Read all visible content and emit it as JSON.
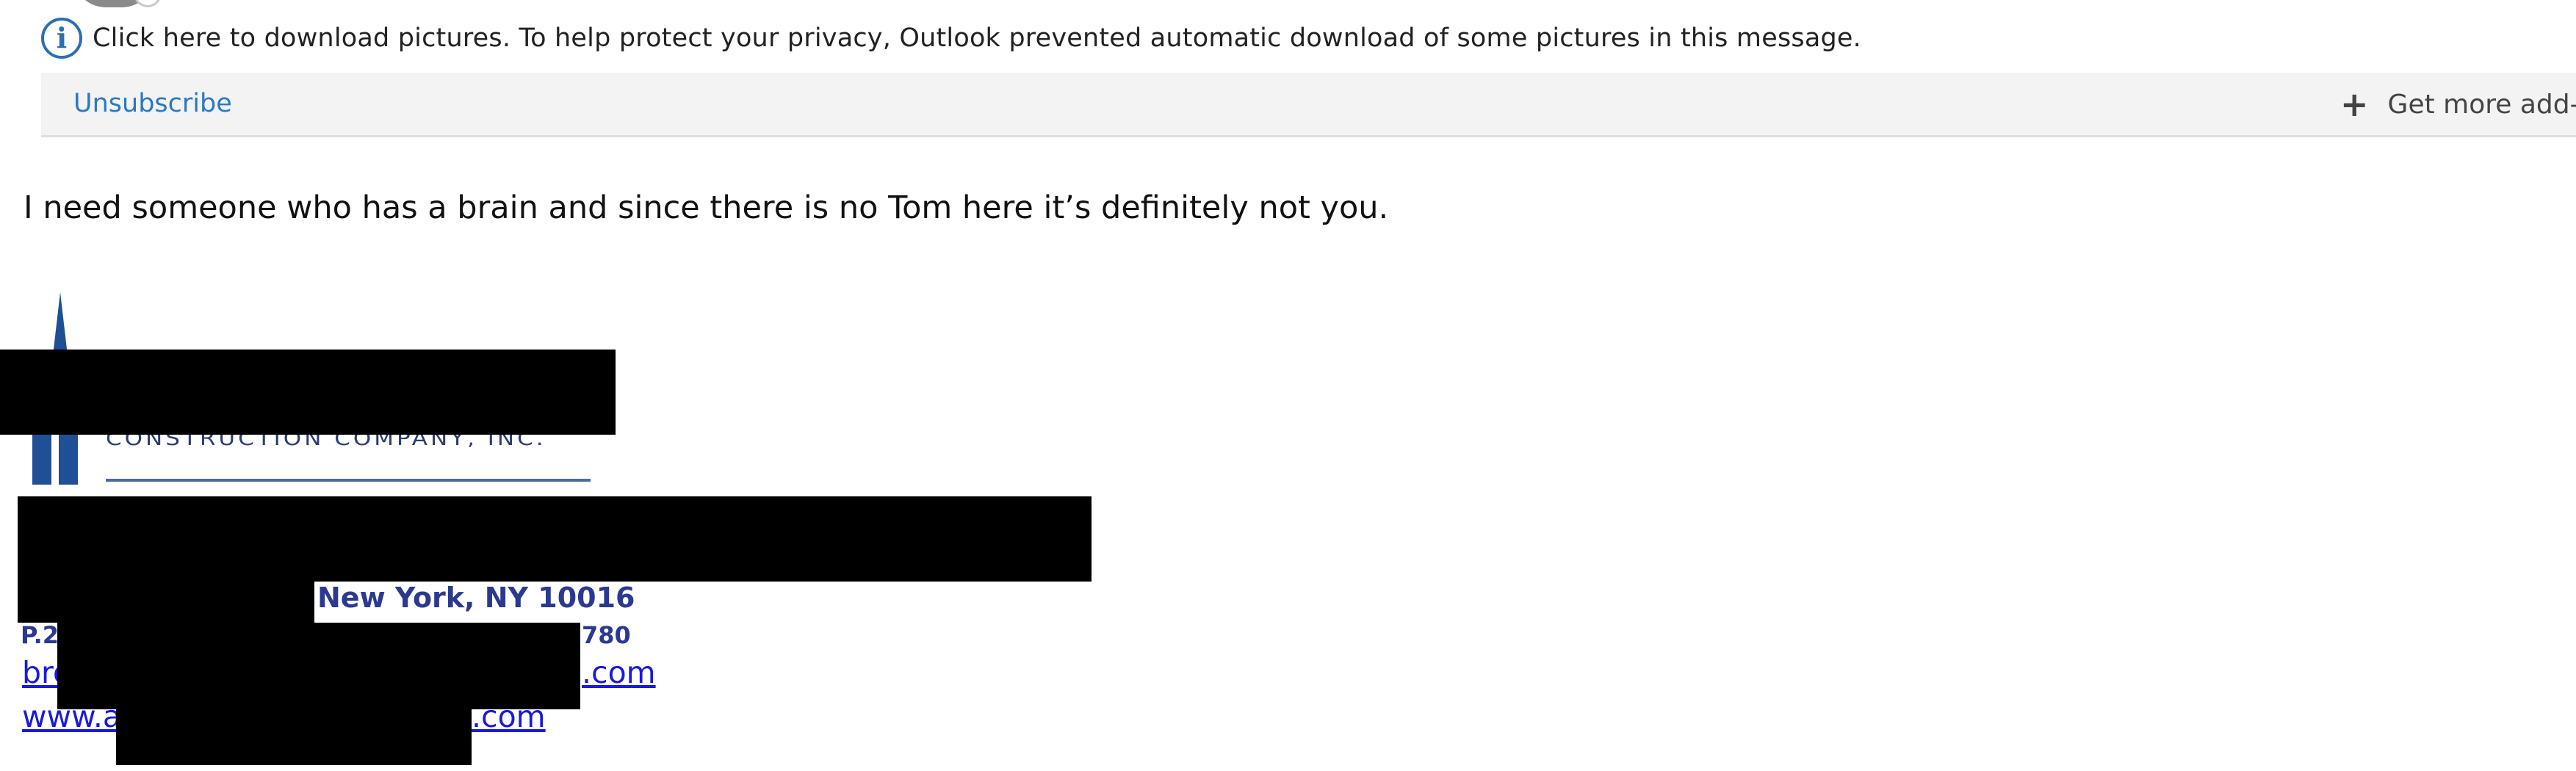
{
  "notice": {
    "icon": "info-icon",
    "text": "Click here to download pictures. To help protect your privacy, Outlook prevented automatic download of some pictures in this message."
  },
  "addin_bar": {
    "unsubscribe_label": "Unsubscribe",
    "plus_icon": "plus-icon",
    "get_addins_label": "Get more add-"
  },
  "message": {
    "body": "I need someone who has a brain and since there is no Tom here it’s definitely not you."
  },
  "signature": {
    "logo_tagline": "CONSTRUCTION  COMPANY, INC.",
    "address_visible": "New York, NY  10016",
    "phone_start": "P.2",
    "phone_end": "780",
    "email_start": "bro",
    "email_end": ".com",
    "website_start": "www.a",
    "website_end": ".com"
  },
  "colors": {
    "info_blue": "#2b6fb3",
    "link_blue": "#2b79c2",
    "signature_navy": "#2b3a8f",
    "hyperlink": "#1a1adb",
    "addin_bar_bg": "#f3f3f3"
  }
}
